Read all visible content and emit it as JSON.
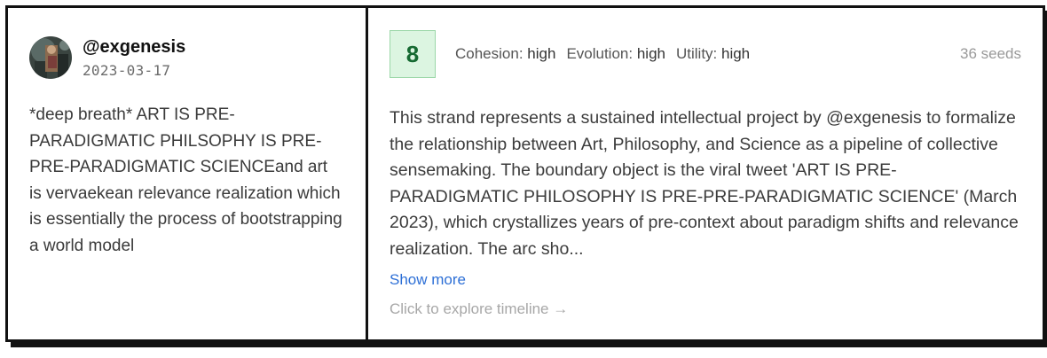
{
  "author": {
    "handle": "@exgenesis",
    "date": "2023-03-17"
  },
  "tweet": {
    "text": "*deep breath* ART IS PRE-PARADIGMATIC PHILSOPHY IS PRE-PRE-PARADIGMATIC SCIENCEand art is vervaekean relevance realization which is essentially the process of bootstrapping a world model"
  },
  "strand": {
    "score": "8",
    "metrics": [
      {
        "label": "Cohesion:",
        "value": "high"
      },
      {
        "label": "Evolution:",
        "value": "high"
      },
      {
        "label": "Utility:",
        "value": "high"
      }
    ],
    "seeds": "36 seeds",
    "summary": "This strand represents a sustained intellectual project by @exgenesis to formalize the relationship between Art, Philosophy, and Science as a pipeline of collective sensemaking. The boundary object is the viral tweet 'ART IS PRE-PARADIGMATIC PHILOSOPHY IS PRE-PRE-PARADIGMATIC SCIENCE' (March 2023), which crystallizes years of pre-context about paradigm shifts and relevance realization. The arc sho...",
    "show_more": "Show more",
    "explore": "Click to explore timeline →"
  },
  "colors": {
    "score_bg": "#dcf5e1",
    "score_text": "#166a32",
    "link": "#2d6fd6"
  }
}
